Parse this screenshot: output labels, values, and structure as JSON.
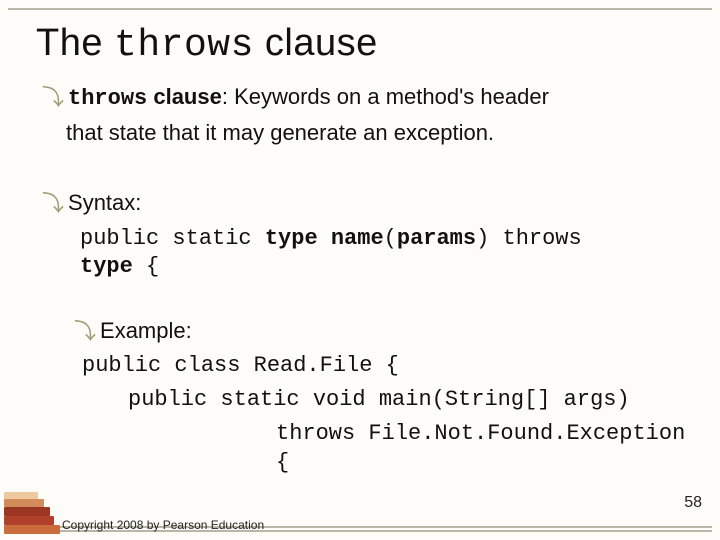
{
  "title": {
    "pre": "The ",
    "code": "throws",
    "post": " clause"
  },
  "definition": {
    "term_code": "throws",
    "term_post": " clause",
    "rest_line1": ": Keywords on a method's header",
    "line2": "that state that it may generate an exception."
  },
  "syntax": {
    "label": "Syntax:",
    "line1_pre": "public static ",
    "line1_type": "type",
    "line1_sep1": " ",
    "line1_name": "name",
    "line1_paren_open": "(",
    "line1_params": "params",
    "line1_paren_close": ")",
    "line1_sep2": " ",
    "line1_throws": "throws",
    "line2_type": "type",
    "line2_brace": " {"
  },
  "example": {
    "label": "Example:",
    "line1": "public class Read.File {",
    "line2": "public static void main(String[] args)",
    "line3": "throws File.Not.Found.Exception {"
  },
  "footer": {
    "copyright": "Copyright 2008 by Pearson Education",
    "page": "58"
  }
}
